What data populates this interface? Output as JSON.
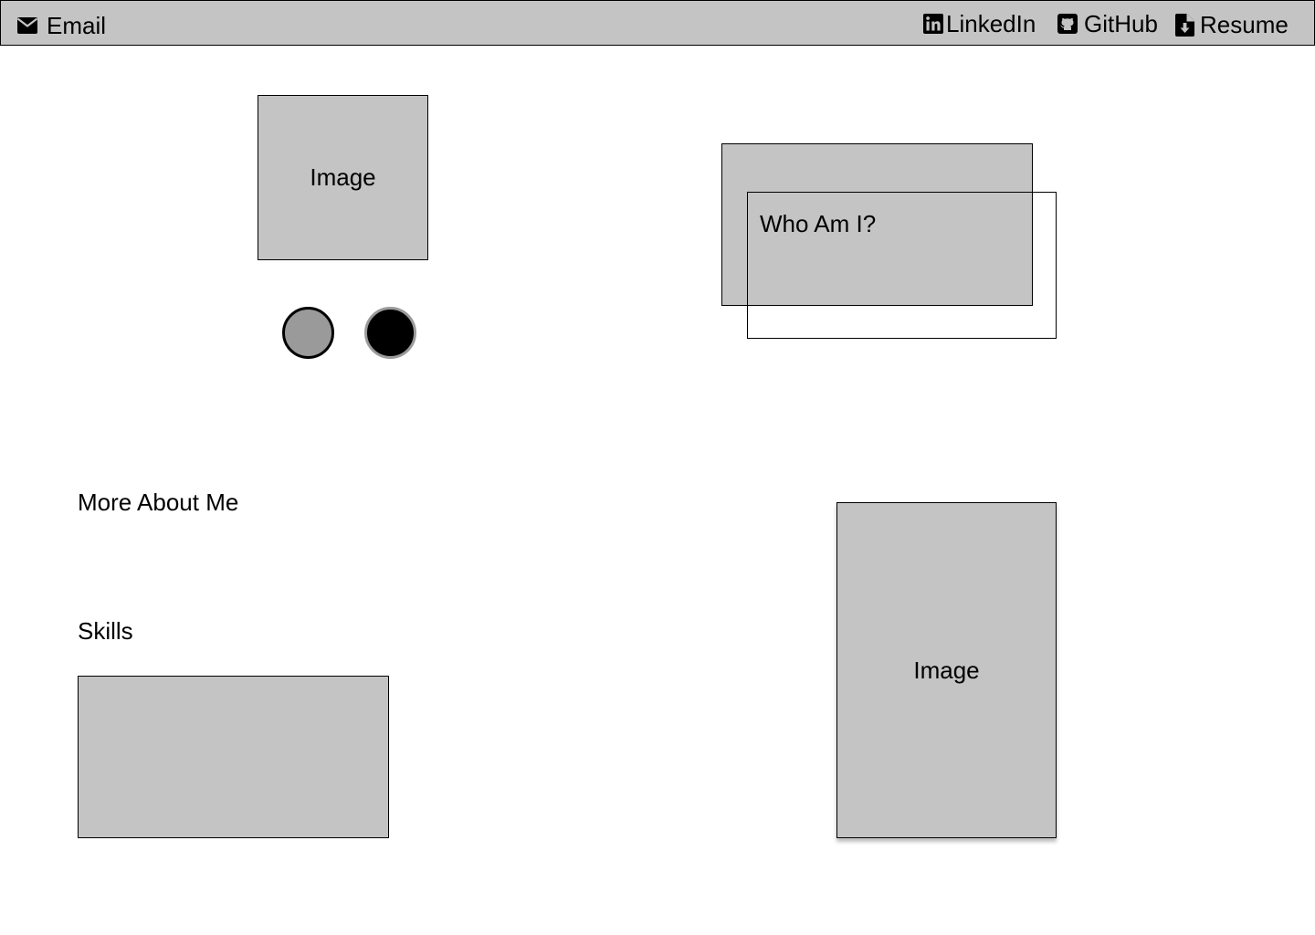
{
  "nav": {
    "email": {
      "label": "Email",
      "icon": "envelope-icon"
    },
    "linkedin": {
      "label": "LinkedIn",
      "icon": "linkedin-icon"
    },
    "github": {
      "label": "GitHub",
      "icon": "github-icon"
    },
    "resume": {
      "label": "Resume",
      "icon": "file-download-icon"
    }
  },
  "hero": {
    "image_label": "Image",
    "carousel_dots": [
      {
        "state": "inactive",
        "color": "#9a9a9a"
      },
      {
        "state": "active",
        "color": "#000000"
      }
    ]
  },
  "about": {
    "title": "Who Am I?"
  },
  "more": {
    "title": "More About Me"
  },
  "skills": {
    "title": "Skills"
  },
  "gallery": {
    "image_label": "Image"
  },
  "colors": {
    "placeholder_fill": "#c4c4c4",
    "border": "#000000",
    "background": "#ffffff"
  }
}
